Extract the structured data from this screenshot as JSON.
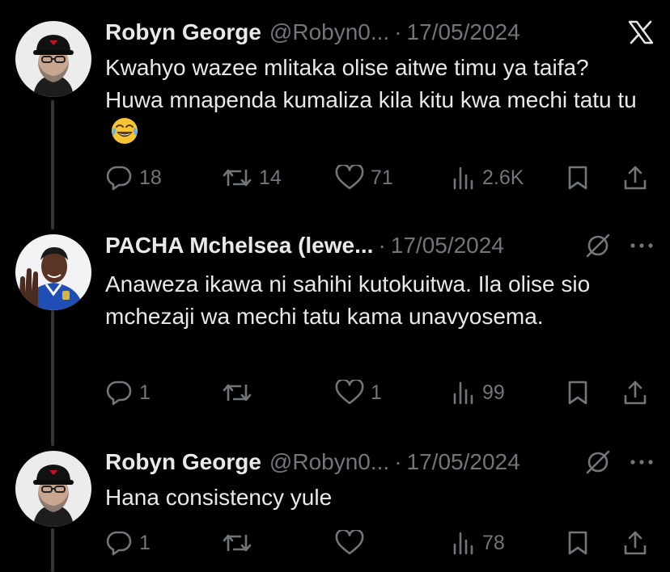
{
  "tweets": [
    {
      "name": "Robyn George",
      "handle": "@Robyn0...",
      "separator": "·",
      "date": "17/05/2024",
      "text": "Kwahyo wazee mlitaka olise aitwe timu ya taifa? Huwa mnapenda kumaliza kila kitu kwa mechi tatu tu",
      "emoji": "face-with-tears-of-joy",
      "replies": "18",
      "reposts": "14",
      "likes": "71",
      "views": "2.6K",
      "header_icons": [
        "x-logo-icon"
      ]
    },
    {
      "name": "PACHA Mchelsea (lewe...",
      "handle": "",
      "separator": "·",
      "date": "17/05/2024",
      "text": "Anaweza ikawa ni sahihi kutokuitwa. Ila olise sio mchezaji wa mechi tatu kama unavyosema.",
      "replies": "1",
      "reposts": "",
      "likes": "1",
      "views": "99",
      "header_icons": [
        "grok-icon",
        "more-icon"
      ]
    },
    {
      "name": "Robyn George",
      "handle": "@Robyn0...",
      "separator": "·",
      "date": "17/05/2024",
      "text": "Hana consistency yule",
      "replies": "1",
      "reposts": "",
      "likes": "",
      "views": "78",
      "header_icons": [
        "grok-icon",
        "more-icon"
      ]
    }
  ],
  "colors": {
    "background": "#000000",
    "primary_text": "#e7e9ea",
    "secondary_text": "#71767b",
    "thread_line": "#333639"
  }
}
